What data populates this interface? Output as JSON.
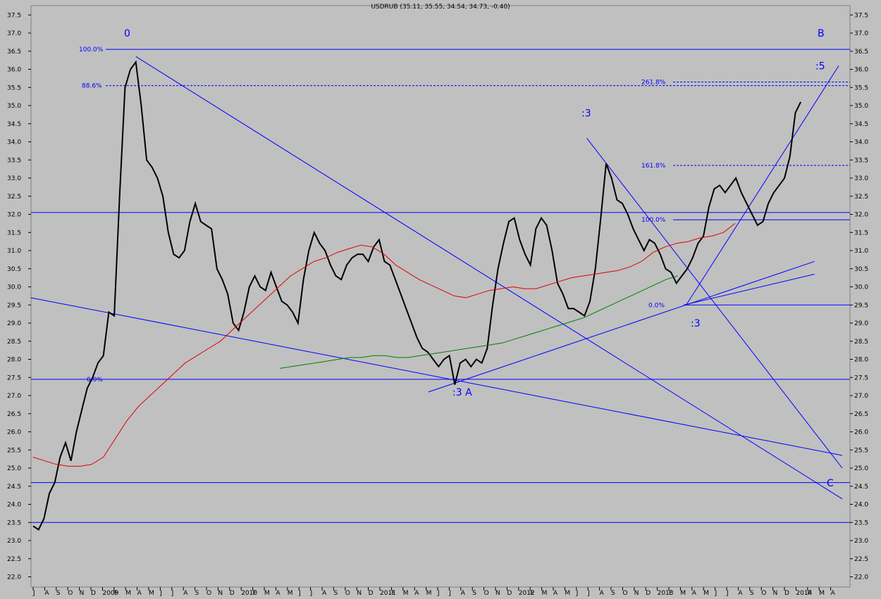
{
  "chart_data": {
    "type": "line",
    "title": "USDRUB (35.11, 35.55, 34.54, 34.73, -0.40)",
    "xlabel": "",
    "ylabel": "",
    "ylim": [
      21.8,
      37.7
    ],
    "y_ticks": [
      "22.0",
      "22.5",
      "23.0",
      "23.5",
      "24.0",
      "24.5",
      "25.0",
      "25.5",
      "26.0",
      "26.5",
      "27.0",
      "27.5",
      "28.0",
      "28.5",
      "29.0",
      "29.5",
      "30.0",
      "30.5",
      "31.0",
      "31.5",
      "32.0",
      "32.5",
      "33.0",
      "33.5",
      "34.0",
      "34.5",
      "35.0",
      "35.5",
      "36.0",
      "36.5",
      "37.0",
      "37.5"
    ],
    "x_ticks": [
      "J",
      "A",
      "S",
      "O",
      "N",
      "D",
      "2009",
      "F",
      "M",
      "A",
      "M",
      "J",
      "J",
      "A",
      "S",
      "O",
      "N",
      "D",
      "2010",
      "F",
      "M",
      "A",
      "M",
      "J",
      "J",
      "A",
      "S",
      "O",
      "N",
      "D",
      "2011",
      "F",
      "M",
      "A",
      "M",
      "J",
      "J",
      "A",
      "S",
      "O",
      "N",
      "D",
      "2012",
      "F",
      "M",
      "A",
      "M",
      "J",
      "J",
      "A",
      "S",
      "O",
      "N",
      "D",
      "2013",
      "F",
      "M",
      "A",
      "M",
      "J",
      "J",
      "A",
      "S",
      "O",
      "N",
      "D",
      "2014",
      "F",
      "M",
      "A"
    ],
    "x_start": "2008-07",
    "series": [
      {
        "values": [
          23.4,
          23.3,
          23.6,
          24.3,
          24.6,
          25.3,
          25.7,
          25.2,
          26.0,
          26.6,
          27.2,
          27.5,
          27.9,
          28.1,
          29.3,
          29.2,
          32.5,
          35.5,
          36.0,
          36.2,
          35.0,
          33.5,
          33.3,
          33.0,
          32.5,
          31.5,
          30.9,
          30.8,
          31.0,
          31.8,
          32.3,
          31.8,
          31.7,
          31.6,
          30.5,
          30.2,
          29.8,
          29.0,
          28.8,
          29.3,
          30.0,
          30.3,
          30.0,
          29.9,
          30.4,
          30.0,
          29.6,
          29.5,
          29.3,
          29.0,
          30.2,
          31.0,
          31.5,
          31.2,
          31.0,
          30.6,
          30.3,
          30.2,
          30.6,
          30.8,
          30.9,
          30.9,
          30.7,
          31.1,
          31.3,
          30.7,
          30.6,
          30.2,
          29.8,
          29.4,
          29.0,
          28.6,
          28.3,
          28.2,
          28.0,
          27.8,
          28.0,
          28.1,
          27.3,
          27.9,
          28.0,
          27.8,
          28.0,
          27.9,
          28.3,
          29.5,
          30.5,
          31.2,
          31.8,
          31.9,
          31.3,
          30.9,
          30.6,
          31.6,
          31.9,
          31.7,
          31.0,
          30.1,
          29.8,
          29.4,
          29.4,
          29.3,
          29.2,
          29.6,
          30.5,
          31.9,
          33.4,
          33.0,
          32.4,
          32.3,
          32.0,
          31.6,
          31.3,
          31.0,
          31.3,
          31.2,
          30.9,
          30.5,
          30.4,
          30.1,
          30.3,
          30.5,
          30.8,
          31.2,
          31.4,
          32.2,
          32.7,
          32.8,
          32.6,
          32.8,
          33.0,
          32.6,
          32.3,
          32.0,
          31.7,
          31.8,
          32.3,
          32.6,
          32.8,
          33.0,
          33.6,
          34.8,
          35.1
        ]
      },
      {
        "name": "",
        "values": [
          25.3,
          25.2,
          25.1,
          25.05,
          25.05,
          25.1,
          25.3,
          25.8,
          26.3,
          26.7,
          27.0,
          27.3,
          27.6,
          27.9,
          28.1,
          28.3,
          28.5,
          28.8,
          29.1,
          29.4,
          29.7,
          30.0,
          30.3,
          30.5,
          30.7,
          30.8,
          30.95,
          31.05,
          31.15,
          31.1,
          30.9,
          30.6,
          30.4,
          30.2,
          30.05,
          29.9,
          29.75,
          29.7,
          29.8,
          29.9,
          29.95,
          30.0,
          29.95,
          29.95,
          30.05,
          30.15,
          30.25,
          30.3,
          30.35,
          30.4,
          30.45,
          30.55,
          30.7,
          30.95,
          31.1,
          31.2,
          31.25,
          31.35,
          31.4,
          31.5,
          31.75
        ]
      },
      {
        "name": "",
        "values": [
          27.75,
          27.8,
          27.85,
          27.9,
          27.95,
          28.0,
          28.05,
          28.05,
          28.1,
          28.1,
          28.05,
          28.05,
          28.1,
          28.15,
          28.2,
          28.25,
          28.3,
          28.35,
          28.4,
          28.45,
          28.55,
          28.65,
          28.75,
          28.85,
          28.95,
          29.05,
          29.15,
          29.3,
          29.45,
          29.6,
          29.75,
          29.9,
          30.05,
          30.2,
          30.3
        ]
      }
    ],
    "horizontal_lines": [
      36.55,
      35.55,
      32.05,
      31.85,
      29.5,
      27.45,
      24.6,
      23.5
    ],
    "fib_labels": [
      "100.0%",
      "88.6%",
      "0.0%",
      "261.8%",
      "161.8%",
      "100.0%",
      "0.0%"
    ],
    "wave_labels": [
      "0",
      "B",
      ":5",
      ":3",
      ":3",
      ":3 A",
      "C"
    ]
  }
}
